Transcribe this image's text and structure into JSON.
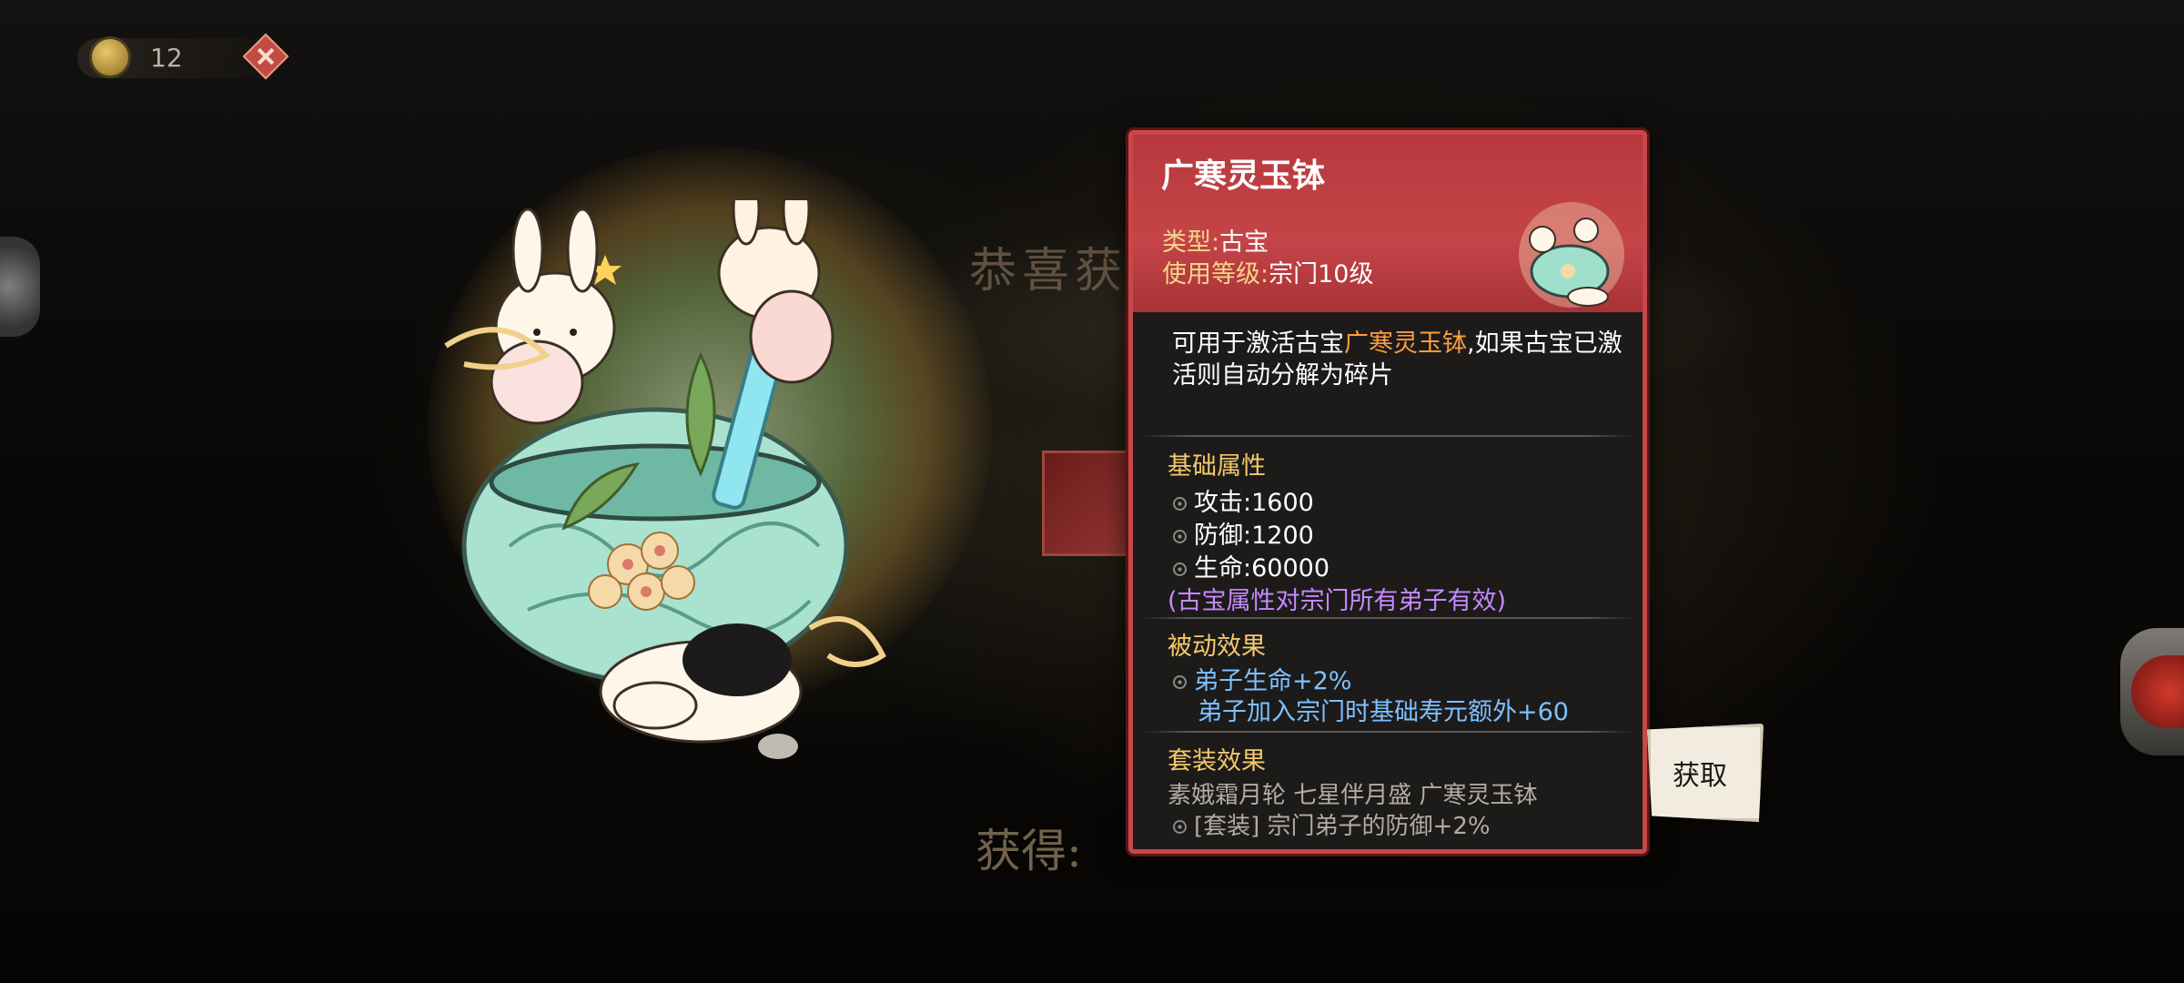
{
  "hud": {
    "resource_count": "12",
    "resource_icon": "coin-icon",
    "add_icon": "plus-icon"
  },
  "background": {
    "title_partial": "恭喜获",
    "obtain_label": "获得:"
  },
  "item": {
    "name": "广寒灵玉钵",
    "type_label": "类型:",
    "type_value": "古宝",
    "level_label": "使用等级:",
    "level_value": "宗门10级",
    "description_prefix": "可用于激活古宝",
    "description_highlight": "广寒灵玉钵",
    "description_suffix": ",如果古宝已激活则自动分解为碎片"
  },
  "base_attributes": {
    "title": "基础属性",
    "stats": [
      {
        "label": "攻击:",
        "value": "1600"
      },
      {
        "label": "防御:",
        "value": "1200"
      },
      {
        "label": "生命:",
        "value": "60000"
      }
    ],
    "note": "(古宝属性对宗门所有弟子有效)"
  },
  "passive": {
    "title": "被动效果",
    "line1": "弟子生命+2%",
    "line2": "弟子加入宗门时基础寿元额外+60"
  },
  "set_effect": {
    "title": "套装效果",
    "set_items": "素娥霜月轮 七星伴月盛 广寒灵玉钵",
    "bonus": "[套装] 宗门弟子的防御+2%"
  },
  "actions": {
    "obtain_button": "获取"
  },
  "colors": {
    "header_red": "#c44448",
    "label_gold": "#f3d58a",
    "highlight_orange": "#ff9d3c",
    "note_purple": "#c889ff",
    "passive_blue": "#7fc0ff"
  }
}
